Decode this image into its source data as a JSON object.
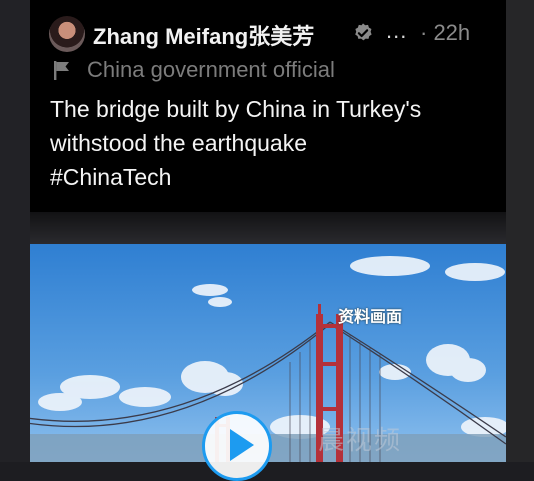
{
  "tweet": {
    "author_name": "Zhang Meifang张美芳",
    "more": "...",
    "timestamp": "· 22h",
    "affiliation_label": "China government official",
    "text_lines": [
      "The bridge built by China in Turkey's",
      "withstood the earthquake",
      "#ChinaTech"
    ],
    "media_overlay_text": "资料画面",
    "media_watermark": "晨视频"
  },
  "colors": {
    "background": "#000000",
    "text": "#f4f4f4",
    "muted": "#7c7c7c",
    "accent": "#1d9bf0"
  },
  "icons": {
    "verified": "verified-badge-icon",
    "affiliation": "flag-icon",
    "play": "play-icon"
  }
}
